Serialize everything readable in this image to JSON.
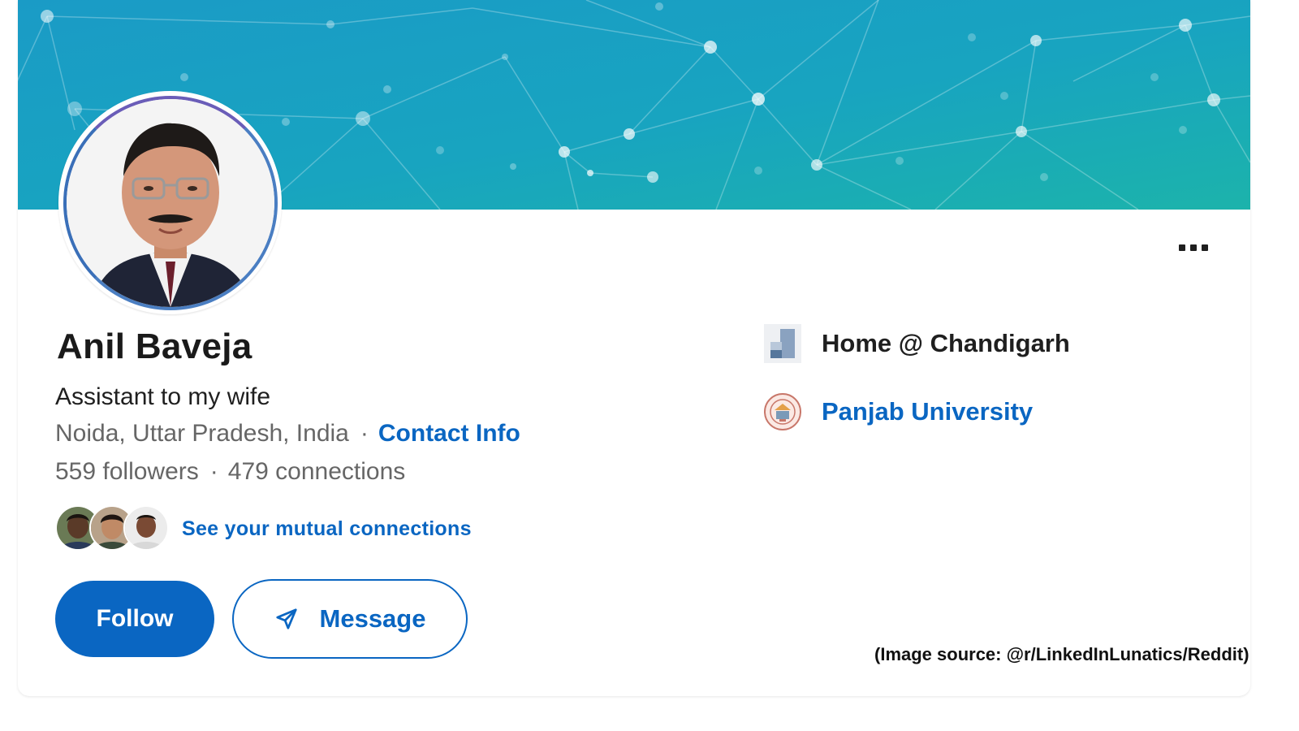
{
  "profile": {
    "name": "Anil Baveja",
    "headline": "Assistant to my wife",
    "location": "Noida, Uttar Pradesh, India",
    "separator": "·",
    "contact_info_label": "Contact Info",
    "followers": "559 followers",
    "connections": "479 connections",
    "mutual_connections_label": "See your mutual connections"
  },
  "actions": {
    "follow_label": "Follow",
    "message_label": "Message",
    "more_icon": "more-horizontal-icon"
  },
  "sidebar": {
    "current_company": "Home @ Chandigarh",
    "education": "Panjab University"
  },
  "footer_note": "(Image source: @r/LinkedInLunatics/Reddit)",
  "colors": {
    "primary": "#0a66c2",
    "banner_start": "#1a9fc4",
    "banner_end": "#1bb0ad",
    "text_dark": "#1a1a1a",
    "text_muted": "#666666"
  }
}
